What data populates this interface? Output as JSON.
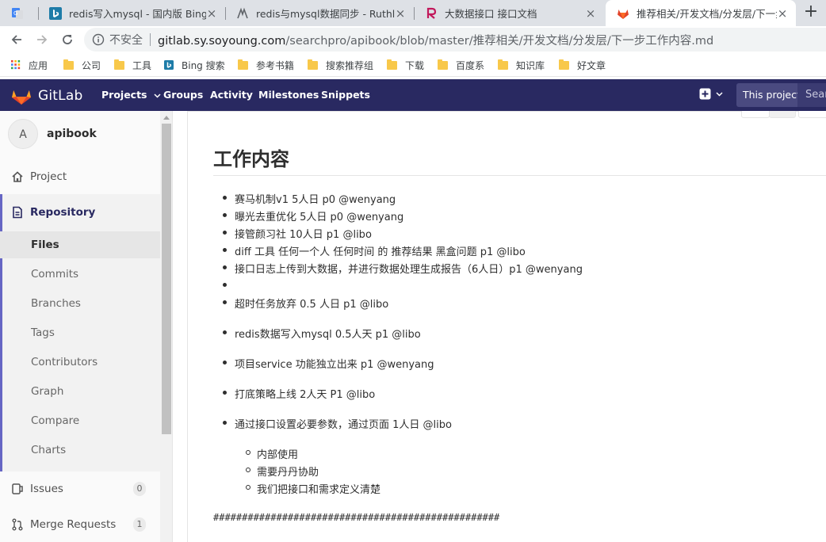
{
  "browser": {
    "tabs": [
      {
        "title": "",
        "favicon": "google-translate-icon"
      },
      {
        "title": "redis写入mysql - 国内版 Bing",
        "favicon": "bing-icon"
      },
      {
        "title": "redis与mysql数据同步 - Ruthless",
        "favicon": "ruthless-icon"
      },
      {
        "title": "大数据接口 接口文档",
        "favicon": "rap-icon"
      },
      {
        "title": "推荐相关/开发文档/分发层/下一步",
        "favicon": "gitlab-icon"
      }
    ],
    "new_tab": "+",
    "security_label": "不安全",
    "url_host": "gitlab.sy.soyoung.com",
    "url_path": "/searchpro/apibook/blob/master/推荐相关/开发文档/分发层/下一步工作内容.md",
    "bookmarks": [
      "应用",
      "公司",
      "工具",
      "Bing 搜索",
      "参考书籍",
      "搜索推荐组",
      "下载",
      "百度系",
      "知识库",
      "好文章"
    ]
  },
  "gitlab": {
    "brand": "GitLab",
    "nav": [
      "Projects",
      "Groups",
      "Activity",
      "Milestones",
      "Snippets"
    ],
    "search_scope": "This project",
    "search_placeholder": "Search",
    "colors": {
      "header": "#292961",
      "accent": "#6666c4"
    }
  },
  "sidebar": {
    "avatar_letter": "A",
    "project_name": "apibook",
    "project": "Project",
    "repository": "Repository",
    "repo_items": [
      "Files",
      "Commits",
      "Branches",
      "Tags",
      "Contributors",
      "Graph",
      "Compare",
      "Charts"
    ],
    "issues": {
      "label": "Issues",
      "count": "0"
    },
    "merge_requests": {
      "label": "Merge Requests",
      "count": "1"
    }
  },
  "document": {
    "heading": "工作内容",
    "items": [
      "赛马机制v1 5人日 p0 @wenyang",
      "曝光去重优化 5人日 p0 @wenyang",
      "接管颜习社 10人日 p1 @libo",
      "diff 工具 任何一个人 任何时间 的 推荐结果 黑盒问题 p1 @libo",
      "接口日志上传到大数据，并进行数据处理生成报告（6人日）p1 @wenyang",
      "",
      "超时任务放弃 0.5 人日 p1 @libo",
      "redis数据写入mysql 0.5人天 p1 @libo",
      "项目service 功能独立出来 p1 @wenyang",
      "打底策略上线 2人天 P1 @libo",
      "通过接口设置必要参数，通过页面 1人日 @libo"
    ],
    "subitems": [
      "内部使用",
      "需要丹丹协助",
      "我们把接口和需求定义清楚"
    ],
    "separator": "##################################################"
  }
}
